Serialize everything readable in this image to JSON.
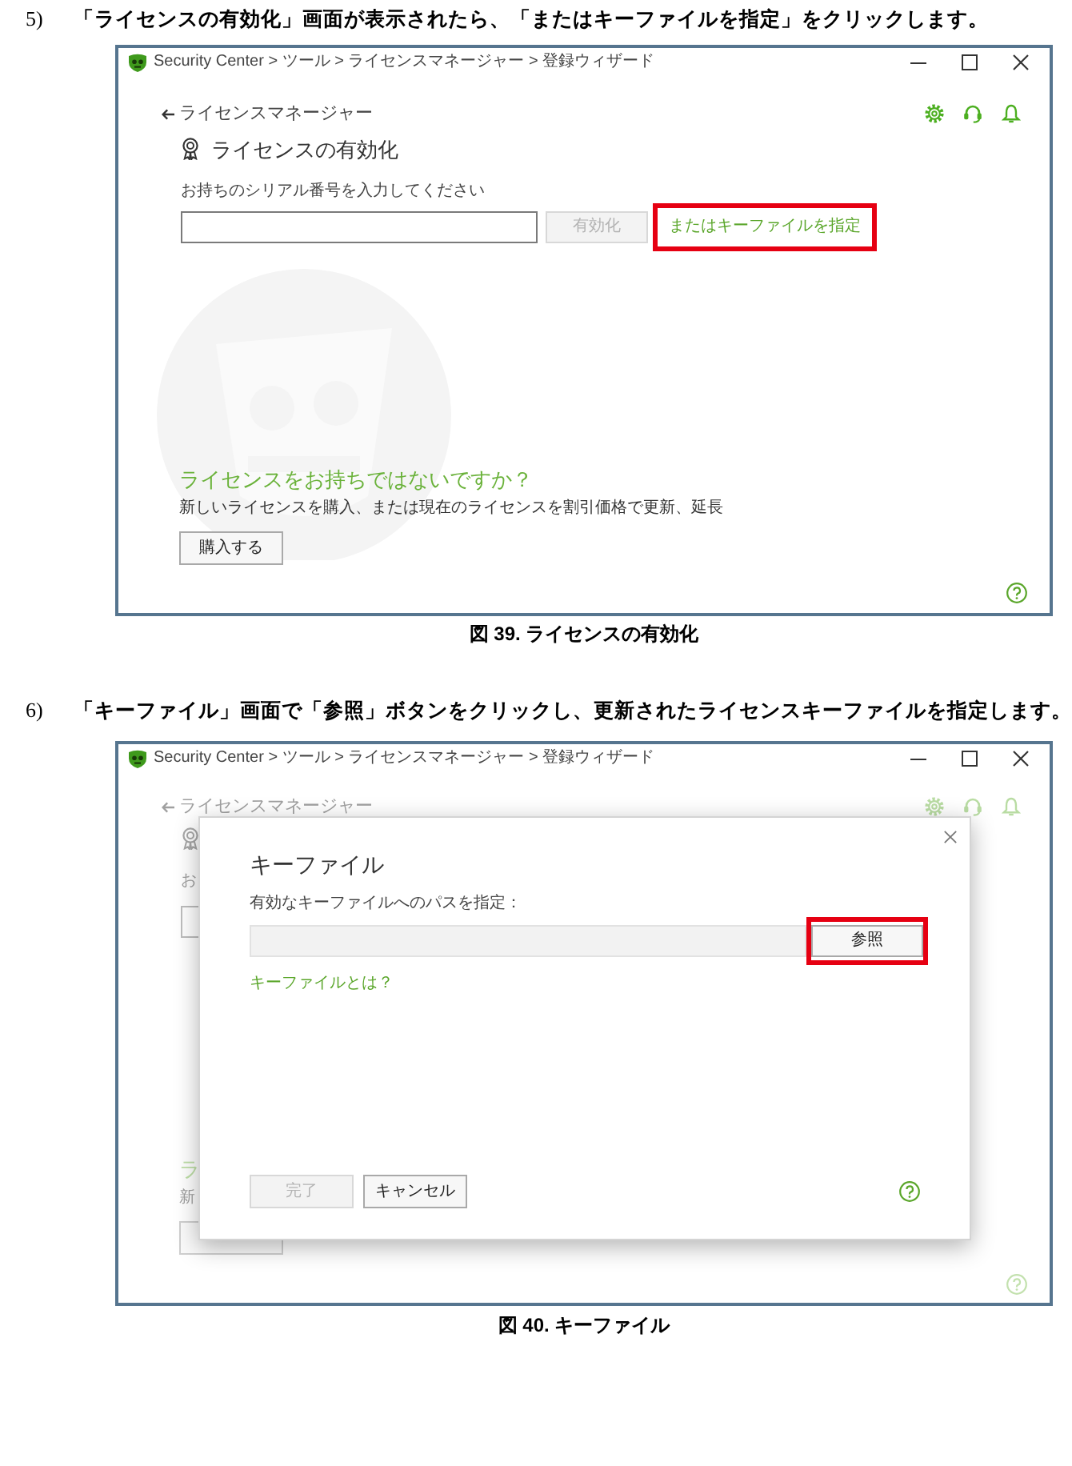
{
  "sections": [
    {
      "number": "5)",
      "instruction": "「ライセンスの有効化」画面が表示されたら、「またはキーファイルを指定」をクリックします。",
      "window": {
        "kind": "activation",
        "title": "Security Center > ツール > ライセンスマネージャー > 登録ウィザード",
        "back_link": "ライセンスマネージャー",
        "heading": "ライセンスの有効化",
        "serial_label": "お持ちのシリアル番号を入力してください",
        "activate_button": {
          "label": "有効化",
          "disabled": true
        },
        "keyfile_link": {
          "label": "またはキーファイルを指定",
          "highlighted": true
        },
        "no_license_title": "ライセンスをお持ちではないですか？",
        "no_license_text": "新しいライセンスを購入、または現在のライセンスを割引価格で更新、延長",
        "purchase_button": "購入する"
      },
      "caption": "図 39. ライセンスの有効化"
    },
    {
      "number": "6)",
      "instruction": "「キーファイル」画面で「参照」ボタンをクリックし、更新されたライセンスキーファイルを指定します。",
      "window": {
        "kind": "key_file_dialog",
        "title": "Security Center > ツール > ライセンスマネージャー > 登録ウィザード",
        "background": {
          "back_link": "ライセンスマネージャー",
          "serial_label": "お",
          "no_license_title": "ラ",
          "no_license_text": "新"
        },
        "dialog": {
          "title": "キーファイル",
          "path_label": "有効なキーファイルへのパスを指定：",
          "browse_button": {
            "label": "参照",
            "highlighted": true
          },
          "help_link": "キーファイルとは？",
          "buttons": [
            {
              "label": "完了",
              "disabled": true
            },
            {
              "label": "キャンセル",
              "disabled": false
            }
          ]
        }
      },
      "caption": "図 40. キーファイル"
    }
  ]
}
